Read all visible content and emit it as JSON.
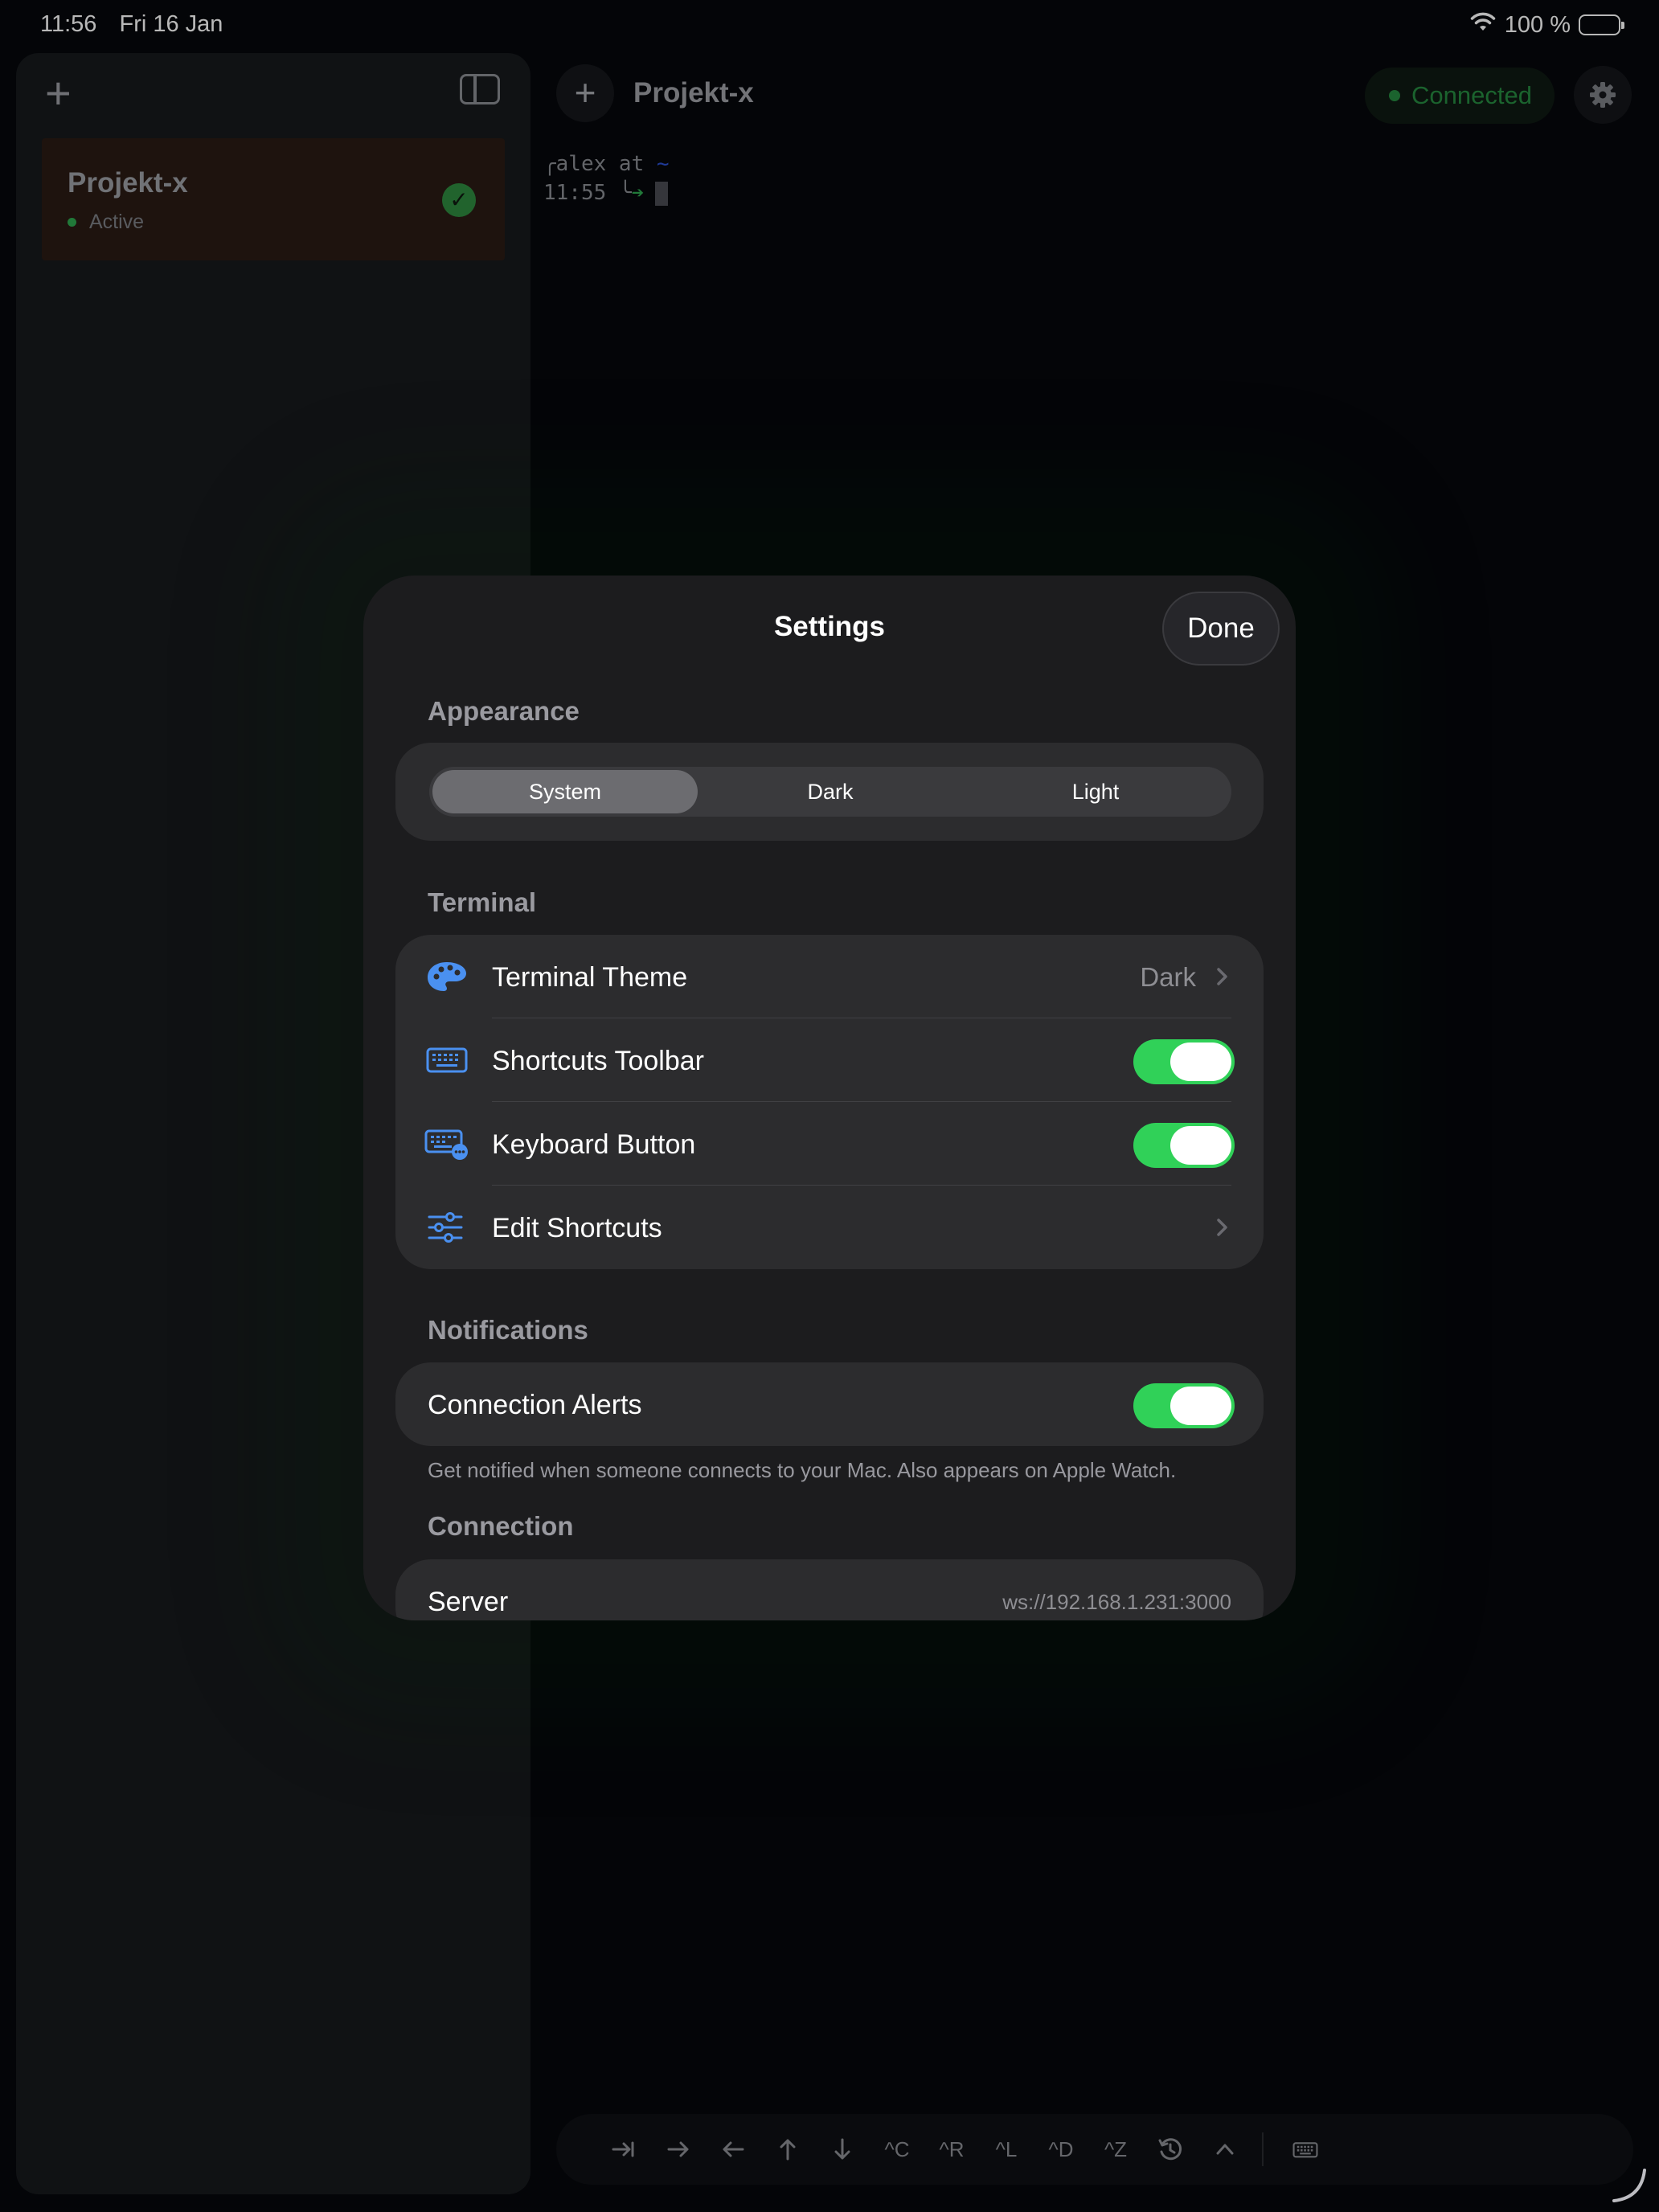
{
  "status_bar": {
    "time": "11:56",
    "date": "Fri 16 Jan",
    "battery": "100 %"
  },
  "sidebar": {
    "sessions": [
      {
        "name": "Projekt-x",
        "status": "Active"
      }
    ]
  },
  "main": {
    "title": "Projekt-x",
    "connection_status": "Connected",
    "terminal": {
      "user_line": "alex at",
      "tilde": "~",
      "time": "11:55"
    }
  },
  "toolbar": {
    "keys": [
      "^C",
      "^R",
      "^L",
      "^D",
      "^Z"
    ]
  },
  "settings": {
    "title": "Settings",
    "done_label": "Done",
    "appearance": {
      "header": "Appearance",
      "options": [
        "System",
        "Dark",
        "Light"
      ],
      "selected": "System"
    },
    "terminal": {
      "header": "Terminal",
      "theme_label": "Terminal Theme",
      "theme_value": "Dark",
      "shortcuts_toolbar_label": "Shortcuts Toolbar",
      "shortcuts_toolbar_on": true,
      "keyboard_button_label": "Keyboard Button",
      "keyboard_button_on": true,
      "edit_shortcuts_label": "Edit Shortcuts"
    },
    "notifications": {
      "header": "Notifications",
      "alerts_label": "Connection Alerts",
      "alerts_on": true,
      "footnote": "Get notified when someone connects to your Mac. Also appears on Apple Watch."
    },
    "connection": {
      "header": "Connection",
      "server_label": "Server",
      "server_value": "ws://192.168.1.231:3000"
    }
  },
  "colors": {
    "accent_blue": "#4a90f0",
    "toggle_green": "#30d158",
    "connected_green": "#268a40"
  }
}
